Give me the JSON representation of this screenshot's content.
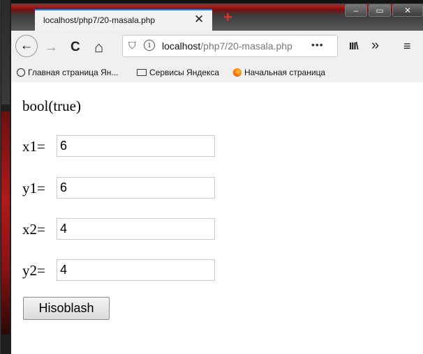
{
  "tab": {
    "title": "localhost/php7/20-masala.php",
    "close_glyph": "✕"
  },
  "newtab_glyph": "+",
  "window_controls": {
    "minimize": "–",
    "maximize": "▭",
    "close": "✕"
  },
  "nav": {
    "back": "←",
    "forward": "→",
    "reload": "C",
    "home": "⌂",
    "url_host": "localhost",
    "url_path": "/php7/20-masala.php",
    "url_more": "•••",
    "library": "III\\",
    "overflow": "»",
    "menu": "≡"
  },
  "bookmarks": [
    {
      "label": "Главная страница Ян...",
      "icon": "globe-icon"
    },
    {
      "label": "Сервисы Яндекса",
      "icon": "folder-icon"
    },
    {
      "label": "Начальная страница",
      "icon": "firefox-icon"
    }
  ],
  "page": {
    "result": "bool(true)",
    "fields": [
      {
        "label": "x1=",
        "value": "6"
      },
      {
        "label": "y1=",
        "value": "6"
      },
      {
        "label": "x2=",
        "value": "4"
      },
      {
        "label": "y2=",
        "value": "4"
      }
    ],
    "submit_label": "Hisoblash"
  },
  "colors": {
    "tab_accent": "#0a84ff",
    "newtab": "#e03030"
  }
}
